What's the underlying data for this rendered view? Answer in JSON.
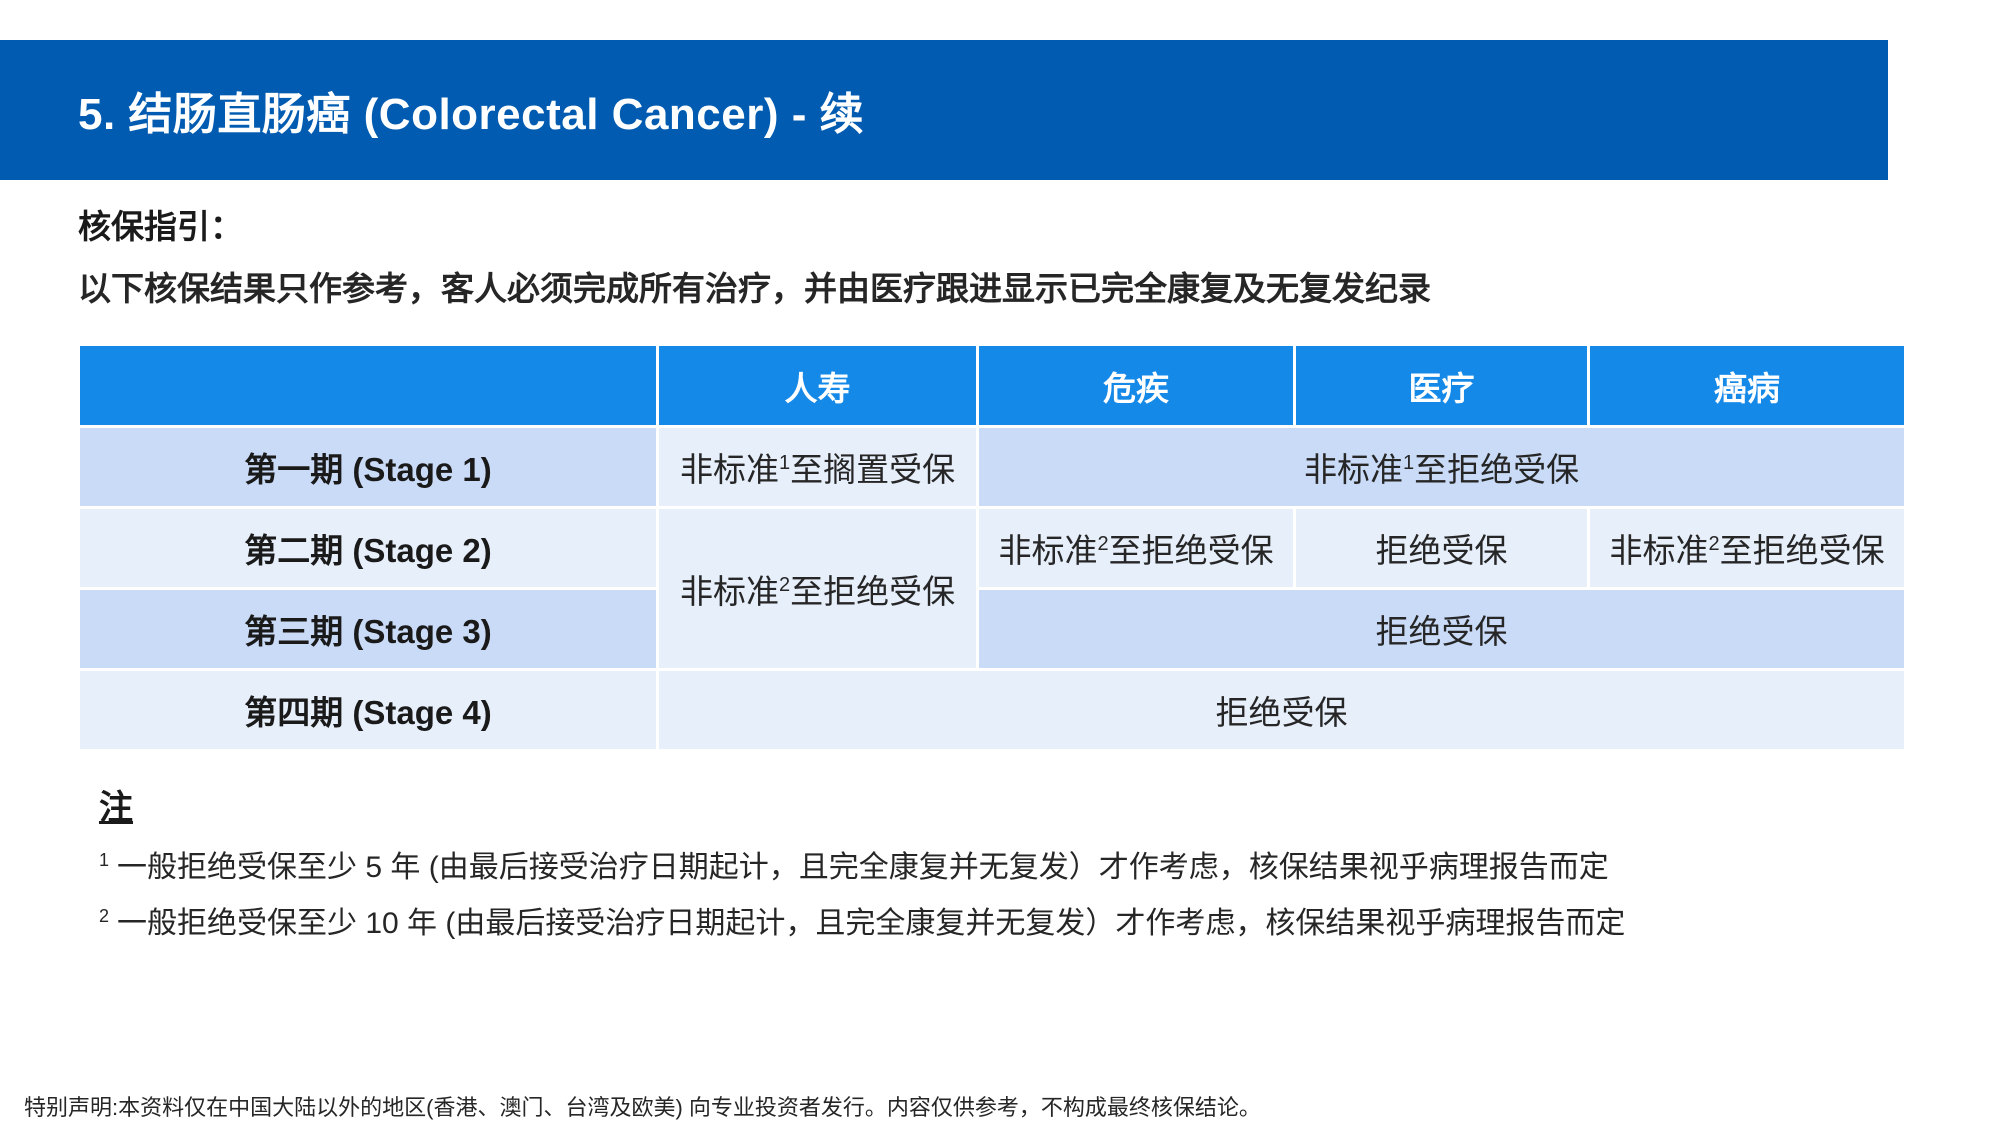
{
  "header": {
    "title": "5.  结肠直肠癌 (Colorectal  Cancer) - 续"
  },
  "guide": {
    "label": "核保指引：",
    "text": "以下核保结果只作参考，客人必须完成所有治疗，并由医疗跟进显示已完全康复及无复发纪录"
  },
  "table": {
    "headers": [
      "",
      "人寿",
      "危疾",
      "医疗",
      "癌病"
    ],
    "rows": [
      {
        "stage": "第一期 (Stage 1)",
        "life": {
          "text": "非标准",
          "sup": "1",
          "rest": "至搁置受保"
        },
        "other": {
          "text": "非标准",
          "sup": "1",
          "rest": "至拒绝受保"
        }
      },
      {
        "stage": "第二期 (Stage 2)",
        "life_merged": {
          "text": "非标准",
          "sup": "2",
          "rest": "至拒绝受保"
        },
        "ci": {
          "text": "非标准",
          "sup": "2",
          "rest": "至拒绝受保"
        },
        "medical": "拒绝受保",
        "cancer": {
          "text": "非标准",
          "sup": "2",
          "rest": "至拒绝受保"
        }
      },
      {
        "stage": "第三期 (Stage 3)",
        "other": "拒绝受保"
      },
      {
        "stage": "第四期 (Stage 4)",
        "all": "拒绝受保"
      }
    ]
  },
  "notes": {
    "title": "注",
    "items": [
      {
        "num": "1",
        "text": "一般拒绝受保至少 5 年 (由最后接受治疗日期起计，且完全康复并无复发）才作考虑，核保结果视乎病理报告而定"
      },
      {
        "num": "2",
        "text": "一般拒绝受保至少 10 年 (由最后接受治疗日期起计，且完全康复并无复发）才作考虑，核保结果视乎病理报告而定"
      }
    ]
  },
  "footer": {
    "disclaimer": "特别声明:本资料仅在中国大陆以外的地区(香港、澳门、台湾及欧美) 向专业投资者发行。内容仅供参考，不构成最终核保结论。"
  },
  "colors": {
    "title_bar": "#005BB1",
    "table_header": "#1589E8",
    "row_dark": "#C9DBF7",
    "row_light": "#E7EFFB"
  }
}
